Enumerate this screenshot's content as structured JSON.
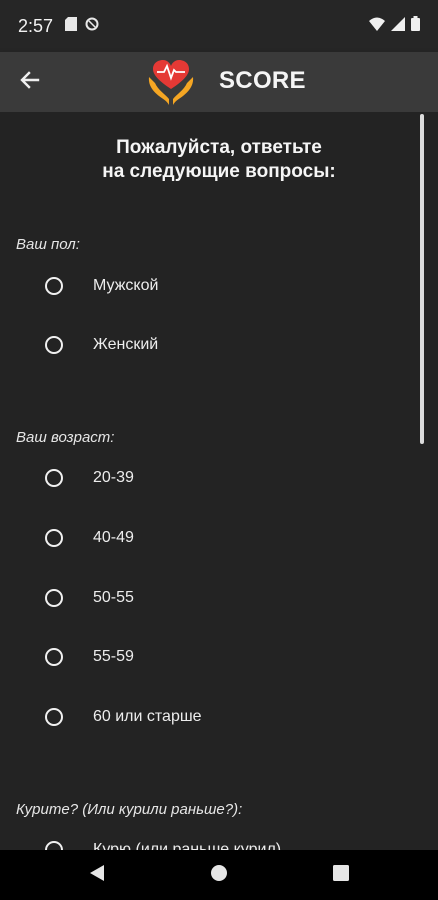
{
  "status_bar": {
    "time": "2:57",
    "icons": [
      "sim-card-icon",
      "data-saver-icon",
      "wifi-icon",
      "signal-icon",
      "battery-icon"
    ]
  },
  "app_bar": {
    "title": "SCORE",
    "logo_icon": "heart-hands-logo",
    "back_icon": "back-arrow-icon"
  },
  "form": {
    "heading_line1": "Пожалуйста, ответьте",
    "heading_line2": "на следующие вопросы:",
    "sections": [
      {
        "label": "Ваш пол:",
        "options": [
          "Мужской",
          "Женский"
        ]
      },
      {
        "label": "Ваш возраст:",
        "options": [
          "20-39",
          "40-49",
          "50-55",
          "55-59",
          "60 или старше"
        ]
      },
      {
        "label": "Курите? (Или курили раньше?):",
        "options": [
          "Курю (или раньше курил)"
        ]
      }
    ]
  },
  "nav_bar": {
    "icons": [
      "back-triangle-icon",
      "home-circle-icon",
      "recents-square-icon"
    ]
  },
  "colors": {
    "background": "#232323",
    "app_bar": "#3a3a3a",
    "accent_red": "#e53935",
    "accent_orange": "#f5a623"
  }
}
